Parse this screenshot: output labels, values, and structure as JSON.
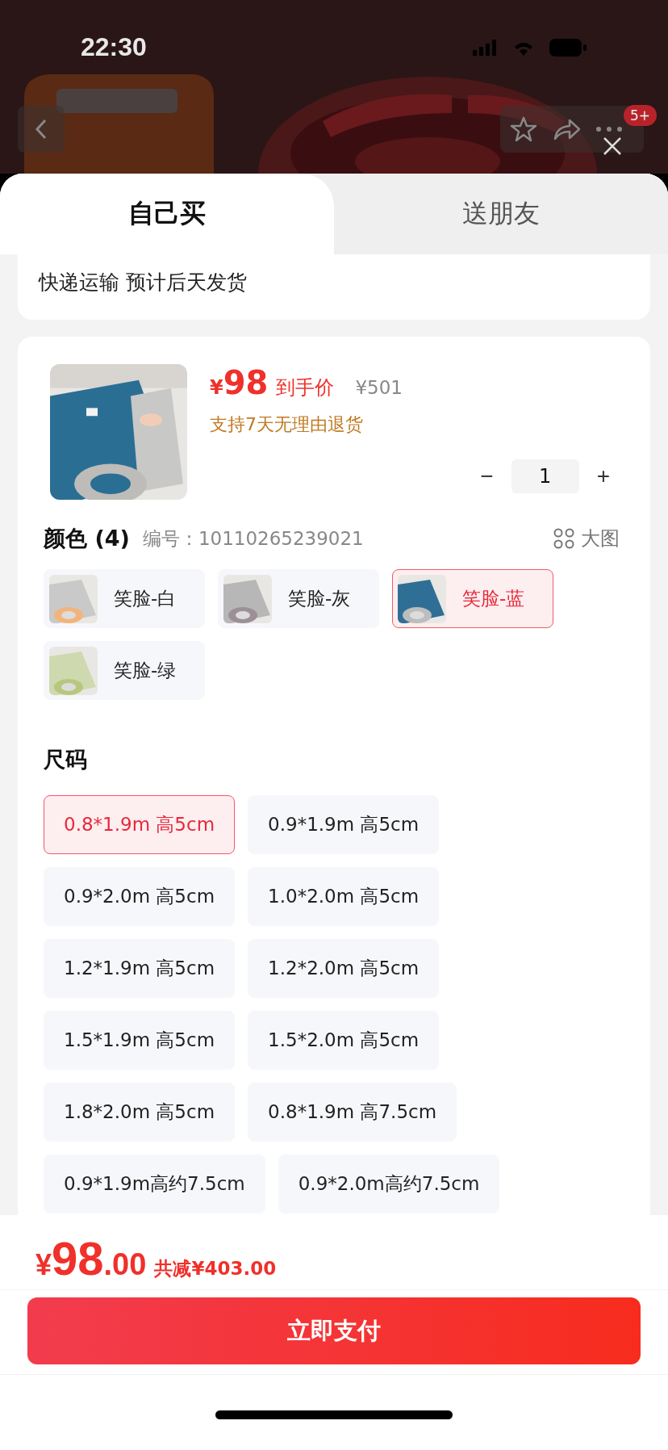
{
  "status_bar": {
    "time": "22:30"
  },
  "top_bar": {
    "badge": "5+"
  },
  "tabs": [
    {
      "label": "自己买",
      "selected": true
    },
    {
      "label": "送朋友",
      "selected": false
    }
  ],
  "shipping": "快递运输 预计后天发货",
  "product": {
    "currency": "¥",
    "price": "98",
    "price_label": "到手价",
    "original_price": "¥501",
    "return_policy": "支持7天无理由退货",
    "quantity_minus": "−",
    "quantity": "1",
    "quantity_plus": "+"
  },
  "colors": {
    "title": "颜色 (4)",
    "code_label": "编号：",
    "code": "10110265239021",
    "gallery_label": "大图",
    "options": [
      {
        "label": "笑脸-白",
        "selected": false
      },
      {
        "label": "笑脸-灰",
        "selected": false
      },
      {
        "label": "笑脸-蓝",
        "selected": true
      },
      {
        "label": "笑脸-绿",
        "selected": false
      }
    ]
  },
  "sizes": {
    "title": "尺码",
    "options": [
      {
        "label": "0.8*1.9m 高5cm",
        "selected": true
      },
      {
        "label": "0.9*1.9m 高5cm",
        "selected": false
      },
      {
        "label": "0.9*2.0m 高5cm",
        "selected": false
      },
      {
        "label": "1.0*2.0m 高5cm",
        "selected": false
      },
      {
        "label": "1.2*1.9m 高5cm",
        "selected": false
      },
      {
        "label": "1.2*2.0m 高5cm",
        "selected": false
      },
      {
        "label": "1.5*1.9m 高5cm",
        "selected": false
      },
      {
        "label": "1.5*2.0m 高5cm",
        "selected": false
      },
      {
        "label": "1.8*2.0m 高5cm",
        "selected": false
      },
      {
        "label": "0.8*1.9m 高7.5cm",
        "selected": false
      },
      {
        "label": "0.9*1.9m高约7.5cm",
        "selected": false
      },
      {
        "label": "0.9*2.0m高约7.5cm",
        "selected": false
      }
    ]
  },
  "footer": {
    "currency": "¥",
    "price_integer": "98",
    "price_decimal": ".00",
    "discount": "共减¥403.00",
    "pay_button": "立即支付"
  }
}
